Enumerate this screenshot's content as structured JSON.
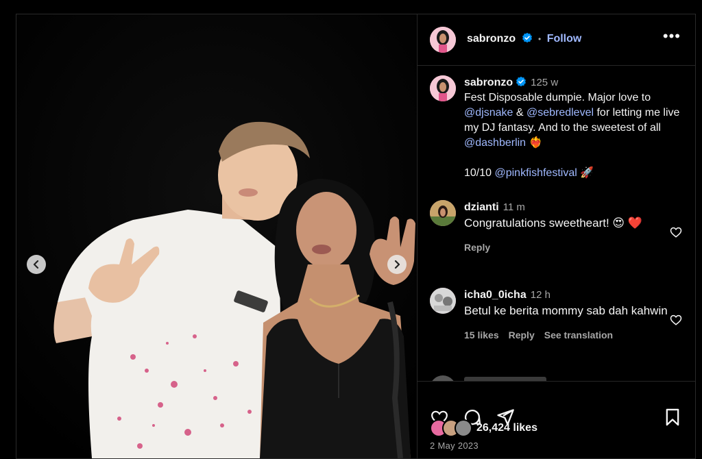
{
  "header": {
    "username": "sabronzo",
    "separator": "•",
    "follow_label": "Follow",
    "more_label": "•••"
  },
  "caption": {
    "username": "sabronzo",
    "time": "125 w",
    "text_1": "Fest Disposable dumpie. Major love to ",
    "mention_1": "@djsnake",
    "text_2": " & ",
    "mention_2": "@sebredlevel",
    "text_3": " for letting me live my DJ fantasy. And to the sweetest of all ",
    "mention_3": "@dashberlin",
    "text_4": " ❤️‍🔥",
    "line2_prefix": "10/10 ",
    "mention_4": "@pinkfishfestival",
    "line2_suffix": " 🚀"
  },
  "comments": [
    {
      "username": "dzianti",
      "time": "11 m",
      "text": "Congratulations sweetheart! 😍 ❤️",
      "reply_label": "Reply"
    },
    {
      "username": "icha0_0icha",
      "time": "12 h",
      "text": "Betul ke berita mommy sab dah kahwin",
      "likes_label": "15 likes",
      "reply_label": "Reply",
      "translate_label": "See translation"
    }
  ],
  "footer": {
    "likes": "26,424 likes",
    "date": "2 May 2023"
  },
  "icons": {
    "like": "heart-icon",
    "comment": "comment-icon",
    "share": "share-icon",
    "save": "bookmark-icon",
    "verified": "verified-badge-icon",
    "prev": "chevron-left-icon",
    "next": "chevron-right-icon"
  },
  "colors": {
    "link": "#a0b9ff",
    "verified": "#0095f6",
    "muted": "#a8a8a8",
    "border": "#262626"
  }
}
